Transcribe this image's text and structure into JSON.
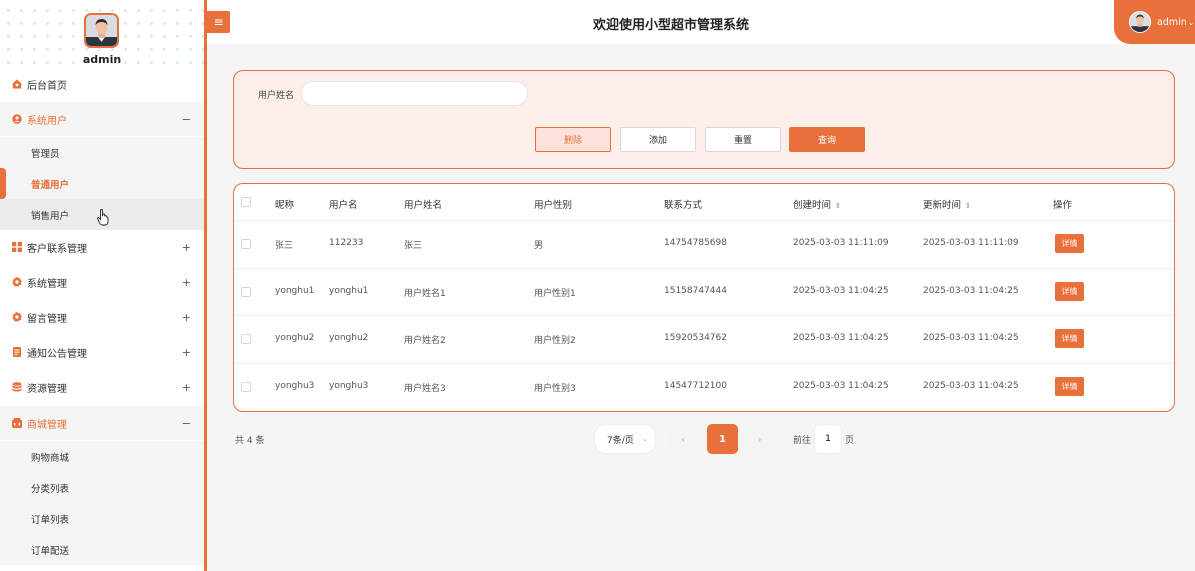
{
  "header": {
    "title": "欢迎使用小型超市管理系统",
    "toggle_icon": "≡",
    "username": "admin",
    "caret": "⌄"
  },
  "sidebar": {
    "profile_name": "admin",
    "menu": {
      "home": "后台首页",
      "system_users": "系统用户",
      "customer_contact": "客户联系管理",
      "system_manage": "系统管理",
      "message_manage": "留言管理",
      "notice_manage": "通知公告管理",
      "resource_manage": "资源管理",
      "mall_manage": "商城管理"
    },
    "submenu_users": [
      "管理员",
      "普通用户",
      "销售用户"
    ],
    "submenu_mall": [
      "购物商城",
      "分类列表",
      "订单列表",
      "订单配送"
    ],
    "expand_sign": "+",
    "collapse_sign": "−"
  },
  "search": {
    "label": "用户姓名",
    "value": "",
    "placeholder": "",
    "buttons": {
      "delete": "删除",
      "add": "添加",
      "reset": "重置",
      "query": "查询"
    }
  },
  "table": {
    "columns": [
      "昵称",
      "用户名",
      "用户姓名",
      "用户性别",
      "联系方式",
      "创建时间",
      "更新时间",
      "操作"
    ],
    "sort_icon": "⇕",
    "action_label": "详情",
    "rows": [
      [
        "张三",
        "112233",
        "张三",
        "男",
        "14754785698",
        "2025-03-03 11:11:09",
        "2025-03-03 11:11:09"
      ],
      [
        "yonghu1",
        "yonghu1",
        "用户姓名1",
        "用户性别1",
        "15158747444",
        "2025-03-03 11:04:25",
        "2025-03-03 11:04:25"
      ],
      [
        "yonghu2",
        "yonghu2",
        "用户姓名2",
        "用户性别2",
        "15920534762",
        "2025-03-03 11:04:25",
        "2025-03-03 11:04:25"
      ],
      [
        "yonghu3",
        "yonghu3",
        "用户姓名3",
        "用户性别3",
        "14547712100",
        "2025-03-03 11:04:25",
        "2025-03-03 11:04:25"
      ]
    ]
  },
  "pagination": {
    "total": "共 4 条",
    "page_size": "7条/页",
    "prev": "‹",
    "next": "›",
    "current_page": "1",
    "goto_label": "前往",
    "goto_value": "1",
    "goto_suffix": "页"
  },
  "colors": {
    "accent": "#e8703a",
    "panel_bg": "#fcefe9"
  }
}
